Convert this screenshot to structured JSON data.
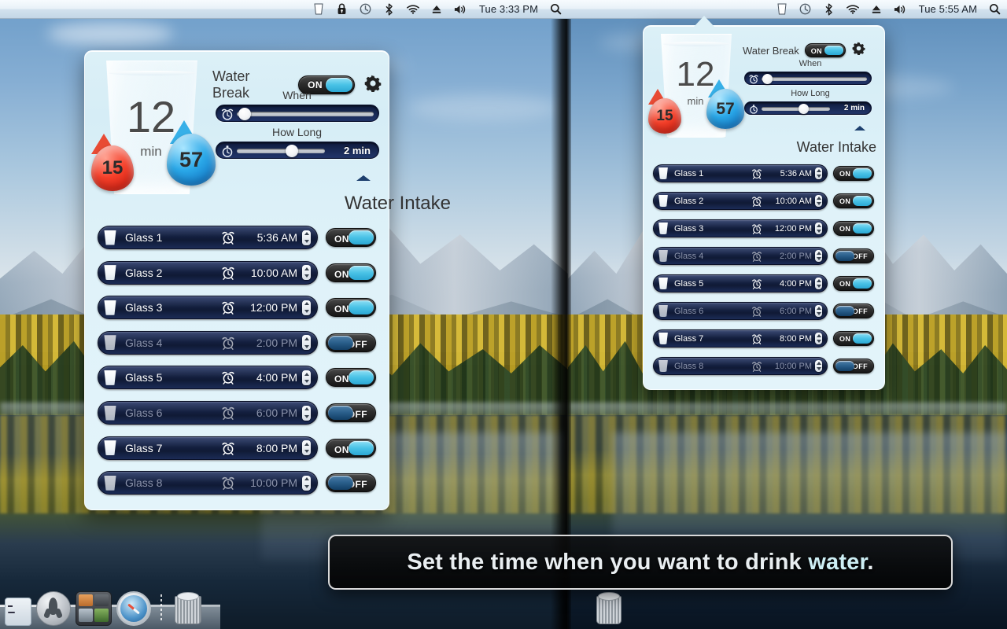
{
  "menubar_left": {
    "icons": [
      "trash-icon",
      "lock-icon",
      "time-machine-icon",
      "bluetooth-icon",
      "wifi-icon",
      "eject-icon",
      "volume-icon"
    ],
    "clock": "Tue 3:33 PM",
    "search_icon": "spotlight-search-icon"
  },
  "menubar_right": {
    "icons": [
      "trash-icon",
      "time-machine-icon",
      "bluetooth-icon",
      "wifi-icon",
      "eject-icon",
      "volume-icon"
    ],
    "clock": "Tue 5:55 AM",
    "search_icon": "spotlight-search-icon"
  },
  "widget": {
    "counter": {
      "minutes": "12",
      "unit": "min",
      "red_drop": "15",
      "blue_drop": "57"
    },
    "water_break": {
      "label": "Water Break",
      "toggle_state": "ON",
      "gear_icon": "gear-icon"
    },
    "when": {
      "label": "When",
      "icon": "alarm-clock-icon",
      "value": "",
      "knob_percent": 7
    },
    "how_long": {
      "label": "How Long",
      "icon": "stopwatch-icon",
      "value": "2 min",
      "knob_percent": 45
    },
    "collapse_icon": "collapse-triangle-icon",
    "intake_title": "Water Intake",
    "glasses": [
      {
        "name": "Glass 1",
        "time": "5:36 AM",
        "state": "ON",
        "enabled": true
      },
      {
        "name": "Glass 2",
        "time": "10:00 AM",
        "state": "ON",
        "enabled": true
      },
      {
        "name": "Glass 3",
        "time": "12:00 PM",
        "state": "ON",
        "enabled": true
      },
      {
        "name": "Glass 4",
        "time": "2:00 PM",
        "state": "OFF",
        "enabled": false
      },
      {
        "name": "Glass 5",
        "time": "4:00 PM",
        "state": "ON",
        "enabled": true
      },
      {
        "name": "Glass 6",
        "time": "6:00 PM",
        "state": "OFF",
        "enabled": false
      },
      {
        "name": "Glass 7",
        "time": "8:00 PM",
        "state": "ON",
        "enabled": true
      },
      {
        "name": "Glass 8",
        "time": "10:00 PM",
        "state": "OFF",
        "enabled": false
      }
    ]
  },
  "caption": {
    "text_before": "Set the time when you want to drink ",
    "highlight": "water",
    "text_after": "."
  },
  "dock": {
    "items": [
      "finder-icon",
      "launchpad-icon",
      "app-folder-stack-icon",
      "safari-icon",
      "trash-can-icon"
    ]
  },
  "colors": {
    "panel_bg": "#dcf0f7",
    "pill_bg": "#162346",
    "toggle_on": "#49c2e6",
    "toggle_off": "#2a5f8c",
    "accent_text": "#cdeef4",
    "menubar_bg": "#e8f1f8"
  }
}
